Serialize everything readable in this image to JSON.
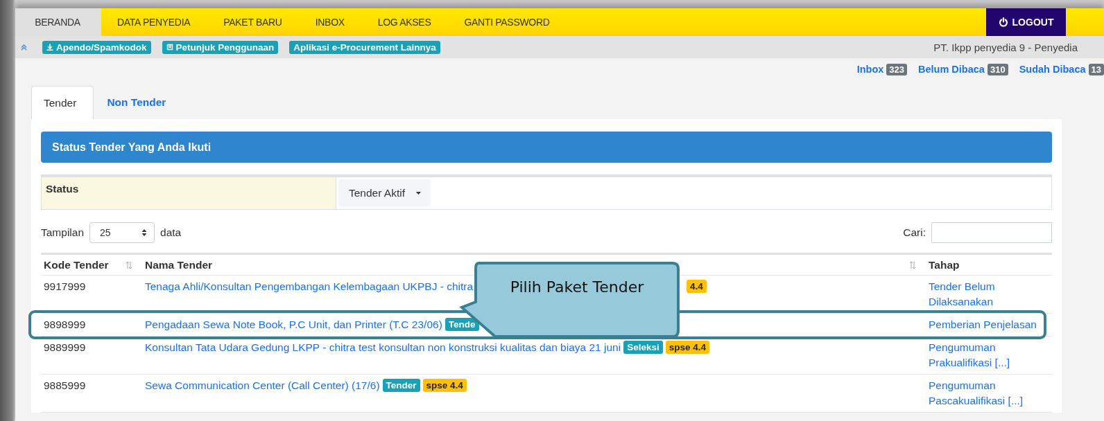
{
  "nav": {
    "items": [
      {
        "label": "BERANDA",
        "selected": true
      },
      {
        "label": "DATA PENYEDIA",
        "selected": false
      },
      {
        "label": "PAKET BARU",
        "selected": false
      },
      {
        "label": "INBOX",
        "selected": false
      },
      {
        "label": "LOG AKSES",
        "selected": false
      },
      {
        "label": "GANTI PASSWORD",
        "selected": false
      }
    ],
    "logout": "LOGOUT"
  },
  "toolbar": {
    "buttons": [
      {
        "label": "Apendo/Spamkodok",
        "kind": "download"
      },
      {
        "label": "Petunjuk Penggunaan",
        "kind": "guide"
      },
      {
        "label": "Aplikasi e-Procurement Lainnya",
        "kind": "plain"
      }
    ],
    "user": "PT. Ikpp penyedia 9 - Penyedia"
  },
  "messages": [
    {
      "label": "Inbox",
      "count": "323"
    },
    {
      "label": "Belum Dibaca",
      "count": "310"
    },
    {
      "label": "Sudah Dibaca",
      "count": "13"
    }
  ],
  "tabs": [
    {
      "label": "Tender",
      "selected": true
    },
    {
      "label": "Non Tender",
      "selected": false
    }
  ],
  "panel": {
    "title": "Status Tender Yang Anda Ikuti",
    "filter": {
      "label": "Status",
      "value": "Tender Aktif"
    },
    "length": {
      "prefix": "Tampilan",
      "value": "25",
      "suffix": "data"
    },
    "search": {
      "label": "Cari:"
    },
    "table": {
      "columns": [
        {
          "label": "Kode Tender",
          "sortable": true
        },
        {
          "label": "Nama Tender",
          "sortable": true
        },
        {
          "label": "Tahap",
          "sortable": false
        }
      ],
      "rows": [
        {
          "code": "9917999",
          "name": "Tenaga Ahli/Konsultan Pengembangan Kelembagaan UKPBJ - chitra",
          "badges": [
            {
              "text": "4.4",
              "kind": "spse"
            }
          ],
          "stage": "Tender Belum Dilaksanakan",
          "highlighted": false,
          "callout": "Pilih Paket Tender"
        },
        {
          "code": "9898999",
          "name": "Pengadaan Sewa Note Book, P.C Unit, dan Printer (T.C 23/06)",
          "badges": [
            {
              "text": "Tende",
              "kind": "method"
            }
          ],
          "stage": "Pemberian Penjelasan",
          "highlighted": true
        },
        {
          "code": "9889999",
          "name": "Konsultan Tata Udara Gedung LKPP - chitra test konsultan non konstruksi kualitas dan biaya 21 juni",
          "badges": [
            {
              "text": "Seleksi",
              "kind": "method"
            },
            {
              "text": "spse 4.4",
              "kind": "spse"
            }
          ],
          "stage": "Pengumuman Prakualifikasi [...]",
          "highlighted": false
        },
        {
          "code": "9885999",
          "name": "Sewa Communication Center (Call Center) (17/6)",
          "badges": [
            {
              "text": "Tender",
              "kind": "method"
            },
            {
              "text": "spse 4.4",
              "kind": "spse"
            }
          ],
          "stage": "Pengumuman Pascakualifikasi [...]",
          "highlighted": false
        }
      ]
    }
  }
}
